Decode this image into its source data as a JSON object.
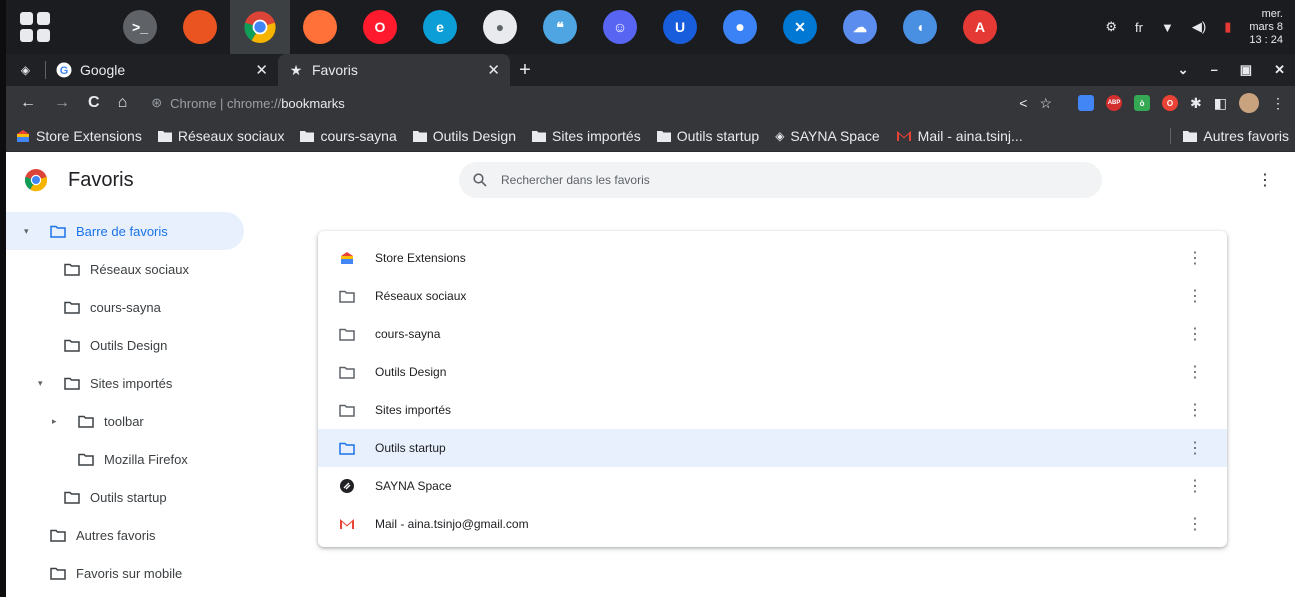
{
  "taskbar": {
    "apps": [
      {
        "name": "terminal-app",
        "color": "#5f6368",
        "glyph": ">_"
      },
      {
        "name": "ubuntu-app",
        "color": "#e95420",
        "glyph": ""
      },
      {
        "name": "chrome-app",
        "color": "#4285f4",
        "glyph": ""
      },
      {
        "name": "firefox-app",
        "color": "#ff7139",
        "glyph": ""
      },
      {
        "name": "opera-app",
        "color": "#ff1b2d",
        "glyph": "O"
      },
      {
        "name": "edge-app",
        "color": "#0c9ed6",
        "glyph": "e"
      },
      {
        "name": "camera-app",
        "color": "#e8eaed",
        "glyph": "●"
      },
      {
        "name": "quote-app",
        "color": "#4ea5e2",
        "glyph": "❝"
      },
      {
        "name": "discord-app",
        "color": "#5865f2",
        "glyph": "☺"
      },
      {
        "name": "bitwarden-app",
        "color": "#175ddc",
        "glyph": "U"
      },
      {
        "name": "toggle-app",
        "color": "#3b82f6",
        "glyph": "⏺"
      },
      {
        "name": "vscode-app",
        "color": "#0078d4",
        "glyph": "✕"
      },
      {
        "name": "cloud-app",
        "color": "#5b8def",
        "glyph": "☁"
      },
      {
        "name": "chat-app",
        "color": "#4a90e2",
        "glyph": "◖"
      },
      {
        "name": "pdf-app",
        "color": "#e53935",
        "glyph": "A"
      }
    ],
    "tray": {
      "settings": "⚙",
      "lang": "fr",
      "wifi": "▼",
      "volume": "◀)",
      "battery": "▮"
    },
    "clock": {
      "day": "mer.",
      "date": "mars 8",
      "time": "13 : 24"
    }
  },
  "tabs": {
    "items": [
      {
        "title": "Google",
        "close": "✕"
      },
      {
        "title": "Favoris",
        "close": "✕"
      }
    ],
    "new_tab": "+",
    "window_controls": {
      "dropdown": "⌄",
      "minimize": "–",
      "restore": "▣",
      "close": "✕"
    }
  },
  "toolbar": {
    "back": "←",
    "forward": "→",
    "reload": "C",
    "home": "⌂",
    "omnibox": {
      "scheme_label": "Chrome",
      "separator": " | ",
      "prefix": "chrome://",
      "path": "bookmarks"
    },
    "share": "<",
    "star": "☆",
    "puzzle": "✱",
    "sidebar": "◧",
    "more": "⋮",
    "extensions": [
      {
        "name": "ext-1",
        "color": "#4285f4",
        "glyph": ""
      },
      {
        "name": "adblock-plus",
        "color": "#d32f2f",
        "glyph": "ABP"
      },
      {
        "name": "ext-3",
        "color": "#34a853",
        "glyph": "ò"
      },
      {
        "name": "ext-4",
        "color": "#ea4335",
        "glyph": "O"
      }
    ]
  },
  "bookmarks_bar": {
    "items": [
      {
        "label": "Store Extensions",
        "icon": "store"
      },
      {
        "label": "Réseaux sociaux",
        "icon": "folder"
      },
      {
        "label": "cours-sayna",
        "icon": "folder"
      },
      {
        "label": "Outils Design",
        "icon": "folder"
      },
      {
        "label": "Sites importés",
        "icon": "folder"
      },
      {
        "label": "Outils startup",
        "icon": "folder"
      },
      {
        "label": "SAYNA Space",
        "icon": "sayna"
      },
      {
        "label": "Mail - aina.tsinj...",
        "icon": "gmail"
      }
    ],
    "other": "Autres favoris"
  },
  "page": {
    "title": "Favoris",
    "search_placeholder": "Rechercher dans les favoris",
    "menu": "⋮",
    "tree": [
      {
        "label": "Barre de favoris",
        "level": 0,
        "arrow": "▾",
        "selected": true
      },
      {
        "label": "Réseaux sociaux",
        "level": 1,
        "arrow": ""
      },
      {
        "label": "cours-sayna",
        "level": 1,
        "arrow": ""
      },
      {
        "label": "Outils Design",
        "level": 1,
        "arrow": ""
      },
      {
        "label": "Sites importés",
        "level": 1,
        "arrow": "▾"
      },
      {
        "label": "toolbar",
        "level": 2,
        "arrow": "▸"
      },
      {
        "label": "Mozilla Firefox",
        "level": 2,
        "arrow": ""
      },
      {
        "label": "Outils startup",
        "level": 1,
        "arrow": ""
      },
      {
        "label": "Autres favoris",
        "level": 0,
        "arrow": ""
      },
      {
        "label": "Favoris sur mobile",
        "level": 0,
        "arrow": ""
      }
    ],
    "list": [
      {
        "label": "Store Extensions",
        "icon": "store"
      },
      {
        "label": "Réseaux sociaux",
        "icon": "folder"
      },
      {
        "label": "cours-sayna",
        "icon": "folder"
      },
      {
        "label": "Outils Design",
        "icon": "folder"
      },
      {
        "label": "Sites importés",
        "icon": "folder"
      },
      {
        "label": "Outils startup",
        "icon": "folder",
        "highlighted": true
      },
      {
        "label": "SAYNA Space",
        "icon": "sayna"
      },
      {
        "label": "Mail - aina.tsinjo@gmail.com",
        "icon": "gmail"
      }
    ],
    "row_menu": "⋮"
  },
  "colors": {
    "accent": "#1a73e8",
    "selected_bg": "#e8f0fe",
    "chrome_dark": "#35363a"
  }
}
